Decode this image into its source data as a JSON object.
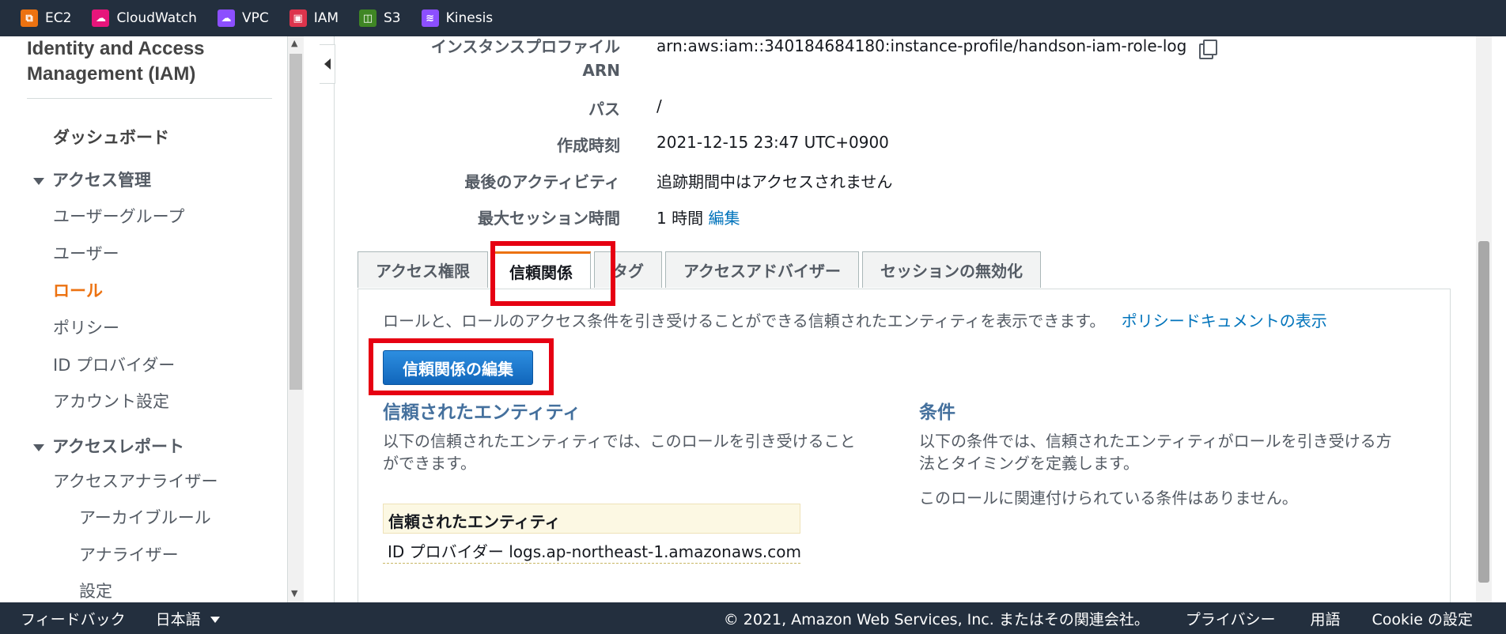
{
  "topbar": {
    "services": [
      {
        "label": "EC2",
        "icon": "ec2-icon",
        "color": "#ec7211"
      },
      {
        "label": "CloudWatch",
        "icon": "cloudwatch-icon",
        "color": "#e7157b"
      },
      {
        "label": "VPC",
        "icon": "vpc-icon",
        "color": "#8c4fff"
      },
      {
        "label": "IAM",
        "icon": "iam-icon",
        "color": "#dd344c"
      },
      {
        "label": "S3",
        "icon": "s3-icon",
        "color": "#3f8624"
      },
      {
        "label": "Kinesis",
        "icon": "kinesis-icon",
        "color": "#8c4fff"
      }
    ]
  },
  "sidebar": {
    "title": "Identity and Access Management (IAM)",
    "dashboard": "ダッシュボード",
    "access_management": "アクセス管理",
    "user_groups": "ユーザーグループ",
    "users": "ユーザー",
    "roles": "ロール",
    "policies": "ポリシー",
    "id_providers": "ID プロバイダー",
    "account_settings": "アカウント設定",
    "access_reports": "アクセスレポート",
    "access_analyzer": "アクセスアナライザー",
    "archive_rules": "アーカイブルール",
    "analyzers": "アナライザー",
    "settings": "設定"
  },
  "summary": {
    "instance_profile_label_1": "インスタンスプロファイル",
    "instance_profile_label_2": "ARN",
    "instance_profile_value": "arn:aws:iam::340184684180:instance-profile/handson-iam-role-log",
    "path_label": "パス",
    "path_value": "/",
    "created_label": "作成時刻",
    "created_value": "2021-12-15 23:47 UTC+0900",
    "last_activity_label": "最後のアクティビティ",
    "last_activity_value": "追跡期間中はアクセスされません",
    "max_session_label": "最大セッション時間",
    "max_session_value": "1 時間",
    "max_session_edit": "編集"
  },
  "tabs": {
    "permissions": "アクセス権限",
    "trust": "信頼関係",
    "tags": "タグ",
    "advisor": "アクセスアドバイザー",
    "revoke": "セッションの無効化"
  },
  "trust_panel": {
    "description": "ロールと、ロールのアクセス条件を引き受けることができる信頼されたエンティティを表示できます。",
    "policy_link": "ポリシードキュメントの表示",
    "edit_button": "信頼関係の編集",
    "entities_title": "信頼されたエンティティ",
    "entities_text_1": "以下の信頼されたエンティティでは、このロールを引き受けること",
    "entities_text_2": "ができます。",
    "conditions_title": "条件",
    "conditions_text_1": "以下の条件では、信頼されたエンティティがロールを引き受ける方",
    "conditions_text_2": "法とタイミングを定義します。",
    "conditions_none": "このロールに関連付けられている条件はありません。",
    "table_header": "信頼されたエンティティ",
    "table_row": "ID プロバイダー logs.ap-northeast-1.amazonaws.com"
  },
  "footer": {
    "feedback": "フィードバック",
    "language": "日本語",
    "copyright": "© 2021, Amazon Web Services, Inc. またはその関連会社。",
    "privacy": "プライバシー",
    "terms": "用語",
    "cookie": "Cookie の設定"
  }
}
